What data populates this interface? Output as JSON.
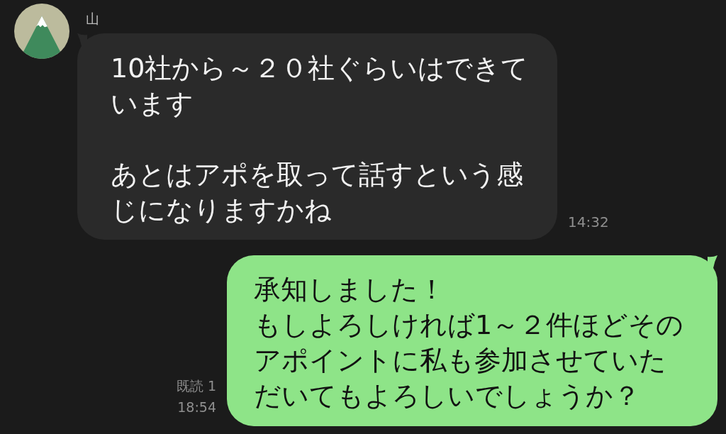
{
  "messages": [
    {
      "kind": "received",
      "sender": "山",
      "paragraphs": [
        "10社から～２０社ぐらいはできています",
        "あとはアポを取って話すという感じになりますかね"
      ],
      "time": "14:32"
    },
    {
      "kind": "sent",
      "paragraphs": [
        "承知しました！",
        "もしよろしければ1～２件ほどそのアポイントに私も参加させていただいてもよろしいでしょうか？"
      ],
      "read_receipt": "既読 1",
      "time": "18:54"
    }
  ]
}
